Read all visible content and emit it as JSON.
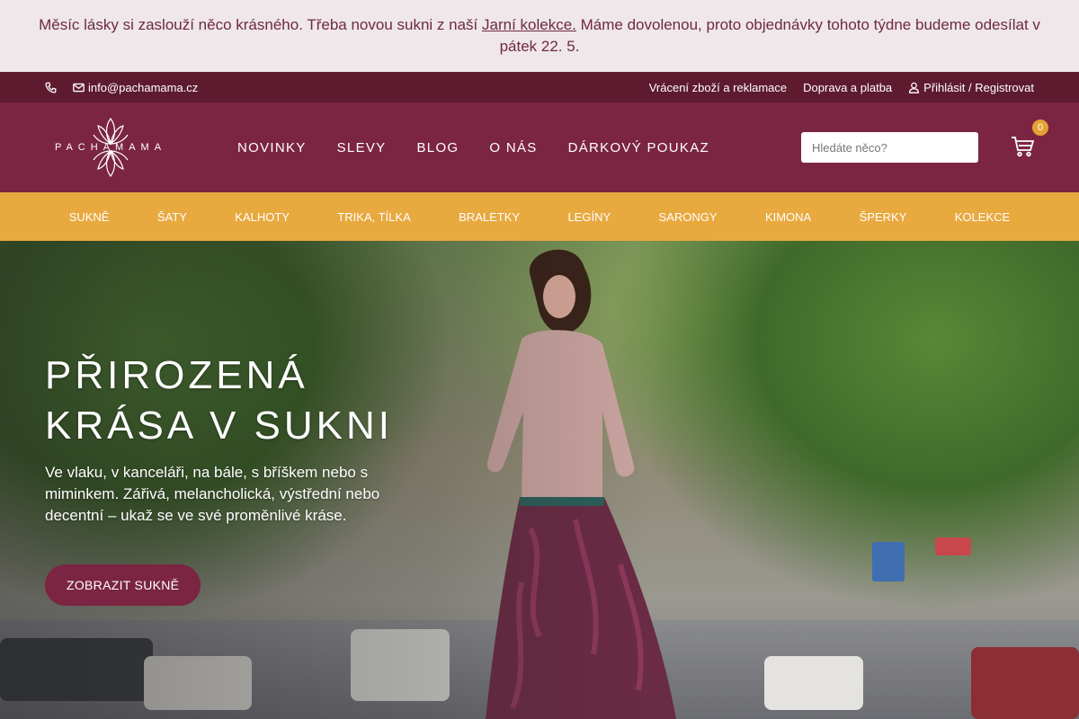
{
  "announcement": {
    "text_before": "Měsíc lásky si zaslouží něco krásného. Třeba novou sukni z naší ",
    "link": "Jarní kolekce.",
    "text_after": " Máme dovolenou, proto objednávky tohoto týdne budeme odesílat v pátek 22. 5."
  },
  "topbar": {
    "phone_icon": "phone-icon",
    "email": "info@pachamama.cz",
    "links": [
      "Vrácení zboží a reklamace",
      "Doprava a platba"
    ],
    "account": "Přihlásit / Registrovat"
  },
  "header": {
    "logo_text": "PACHAMAMA",
    "nav": [
      "NOVINKY",
      "SLEVY",
      "BLOG",
      "O NÁS",
      "DÁRKOVÝ POUKAZ"
    ],
    "search_placeholder": "Hledáte něco?",
    "cart_count": "0"
  },
  "categories": [
    "SUKNĚ",
    "ŠATY",
    "KALHOTY",
    "TRIKA, TÍLKA",
    "BRALETKY",
    "LEGÍNY",
    "SARONGY",
    "KIMONA",
    "ŠPERKY",
    "KOLEKCE"
  ],
  "hero": {
    "title_line1": "PŘIROZENÁ",
    "title_line2": "KRÁSA V SUKNI",
    "text": "Ve vlaku, v kanceláři, na bále, s bříškem nebo s miminkem. Zářivá, melancholická, výstřední nebo decentní – ukaž se ve své proměnlivé kráse.",
    "button": "ZOBRAZIT SUKNĚ"
  },
  "colors": {
    "brand": "#7b2542",
    "brand_dark": "#5e1b30",
    "accent": "#e8a93f"
  }
}
